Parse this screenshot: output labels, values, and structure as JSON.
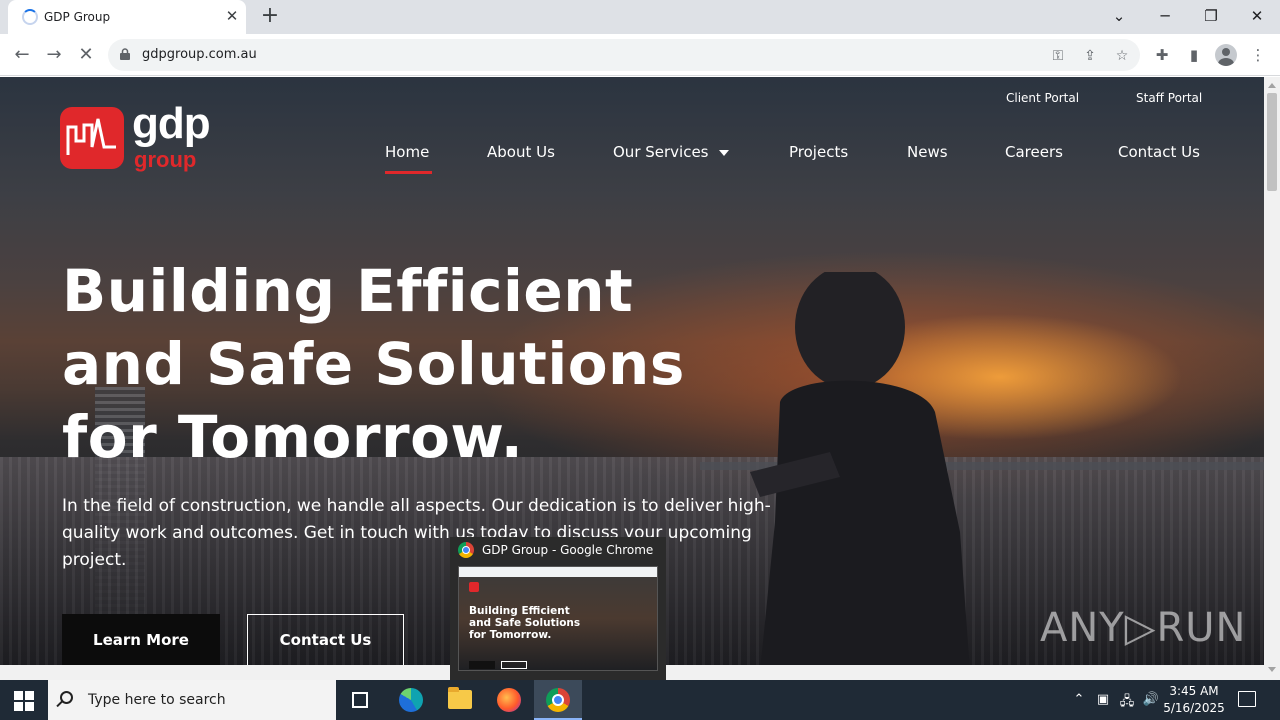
{
  "browser": {
    "tab_title": "GDP Group",
    "tab_close": "✕",
    "new_tab": "+",
    "url": "gdpgroup.com.au",
    "icons": [
      "loading-spinner-icon",
      "back-icon",
      "forward-icon",
      "stop-icon",
      "lock-icon",
      "key-icon",
      "share-icon",
      "star-icon",
      "extensions-icon",
      "side-panel-icon",
      "profile-icon",
      "menu-icon"
    ]
  },
  "site": {
    "logo_text": "gdp",
    "logo_sub": "group",
    "brand_color": "#e0282b",
    "portals": [
      "Client Portal",
      "Staff Portal"
    ],
    "nav": {
      "home": "Home",
      "about": "About Us",
      "services": "Our Services",
      "projects": "Projects",
      "news": "News",
      "careers": "Careers",
      "contact": "Contact Us"
    },
    "hero": {
      "headline_1": "Building Efficient",
      "headline_2": "and Safe Solutions",
      "headline_3": "for Tomorrow.",
      "body": "In the field of construction, we handle all aspects. Our dedication is to deliver high-quality work and outcomes. Get in touch with us today to discuss your upcoming project.",
      "btn_primary": "Learn More",
      "btn_secondary": "Contact Us"
    },
    "watermark": "ANY▷RUN"
  },
  "taskbar_preview": {
    "title": "GDP Group - Google Chrome",
    "thumb_headline_1": "Building Efficient",
    "thumb_headline_2": "and Safe Solutions",
    "thumb_headline_3": "for Tomorrow."
  },
  "taskbar": {
    "search_placeholder": "Type here to search",
    "time": "3:45 AM",
    "date": "5/16/2025"
  }
}
